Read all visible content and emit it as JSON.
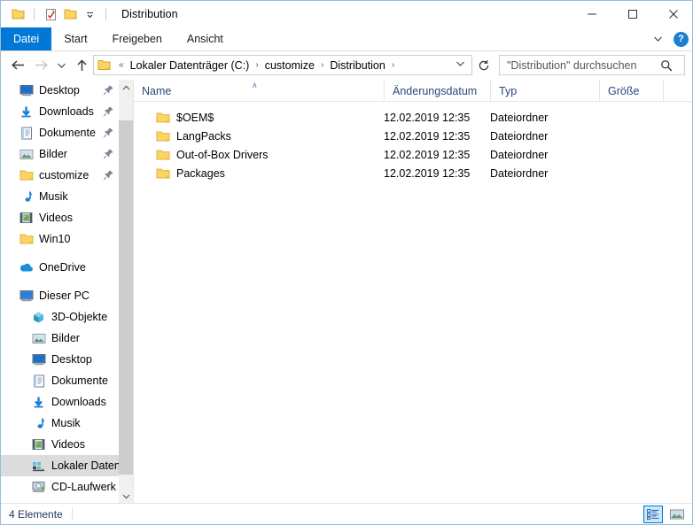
{
  "window": {
    "title": "Distribution",
    "quick_access": [
      {
        "name": "folder-icon",
        "label": ""
      },
      {
        "name": "properties-icon",
        "label": ""
      },
      {
        "name": "new-folder-icon",
        "label": ""
      }
    ],
    "caption": {
      "minimize": "minimize-button",
      "maximize": "maximize-button",
      "close": "close-button"
    }
  },
  "ribbon": {
    "tabs": [
      {
        "label": "Datei",
        "active": true
      },
      {
        "label": "Start",
        "active": false
      },
      {
        "label": "Freigeben",
        "active": false
      },
      {
        "label": "Ansicht",
        "active": false
      }
    ],
    "minimize_label": "",
    "help_label": "?"
  },
  "navbar": {
    "back_tooltip": "Zurück",
    "forward_tooltip": "Vorwärts",
    "recent_tooltip": "Zuletzt besuchte Orte",
    "up_tooltip": "Eine Ebene nach oben",
    "overflow_marker": "«",
    "breadcrumbs": [
      "Lokaler Datenträger (C:)",
      "customize",
      "Distribution"
    ],
    "separator": "›",
    "refresh_label": "↻"
  },
  "search": {
    "placeholder": "\"Distribution\" durchsuchen",
    "value": ""
  },
  "sidebar": {
    "quick_access_items": [
      {
        "label": "Desktop",
        "icon": "desktop-icon",
        "pinned": true
      },
      {
        "label": "Downloads",
        "icon": "downloads-icon",
        "pinned": true
      },
      {
        "label": "Dokumente",
        "icon": "documents-icon",
        "pinned": true
      },
      {
        "label": "Bilder",
        "icon": "pictures-icon",
        "pinned": true
      },
      {
        "label": "customize",
        "icon": "folder-icon",
        "pinned": true
      },
      {
        "label": "Musik",
        "icon": "music-icon",
        "pinned": false
      },
      {
        "label": "Videos",
        "icon": "videos-icon",
        "pinned": false
      },
      {
        "label": "Win10",
        "icon": "folder-icon",
        "pinned": false
      }
    ],
    "onedrive": {
      "label": "OneDrive",
      "icon": "onedrive-icon"
    },
    "this_pc": {
      "label": "Dieser PC",
      "icon": "this-pc-icon"
    },
    "this_pc_items": [
      {
        "label": "3D-Objekte",
        "icon": "3d-objects-icon",
        "selected": false
      },
      {
        "label": "Bilder",
        "icon": "pictures-icon",
        "selected": false
      },
      {
        "label": "Desktop",
        "icon": "desktop-icon",
        "selected": false
      },
      {
        "label": "Dokumente",
        "icon": "documents-icon",
        "selected": false
      },
      {
        "label": "Downloads",
        "icon": "downloads-icon",
        "selected": false
      },
      {
        "label": "Musik",
        "icon": "music-icon",
        "selected": false
      },
      {
        "label": "Videos",
        "icon": "videos-icon",
        "selected": false
      },
      {
        "label": "Lokaler Datenträ",
        "icon": "drive-icon",
        "selected": true
      },
      {
        "label": "CD-Laufwerk (D:",
        "icon": "cd-drive-icon",
        "selected": false
      }
    ]
  },
  "filelist": {
    "columns": [
      {
        "label": "Name",
        "sorted": "asc"
      },
      {
        "label": "Änderungsdatum",
        "sorted": ""
      },
      {
        "label": "Typ",
        "sorted": ""
      },
      {
        "label": "Größe",
        "sorted": ""
      }
    ],
    "sort_caret": "∧",
    "rows": [
      {
        "name": "$OEM$",
        "date": "12.02.2019 12:35",
        "type": "Dateiordner",
        "size": ""
      },
      {
        "name": "LangPacks",
        "date": "12.02.2019 12:35",
        "type": "Dateiordner",
        "size": ""
      },
      {
        "name": "Out-of-Box Drivers",
        "date": "12.02.2019 12:35",
        "type": "Dateiordner",
        "size": ""
      },
      {
        "name": "Packages",
        "date": "12.02.2019 12:35",
        "type": "Dateiordner",
        "size": ""
      }
    ]
  },
  "statusbar": {
    "item_count": "4 Elemente",
    "view_details": "details-view-button",
    "view_large_icons": "large-icons-view-button"
  },
  "colors": {
    "accent": "#0078d7",
    "folder_yellow": "#fcd462",
    "header_text": "#29487d",
    "selection_gray": "#dcdcdc"
  }
}
